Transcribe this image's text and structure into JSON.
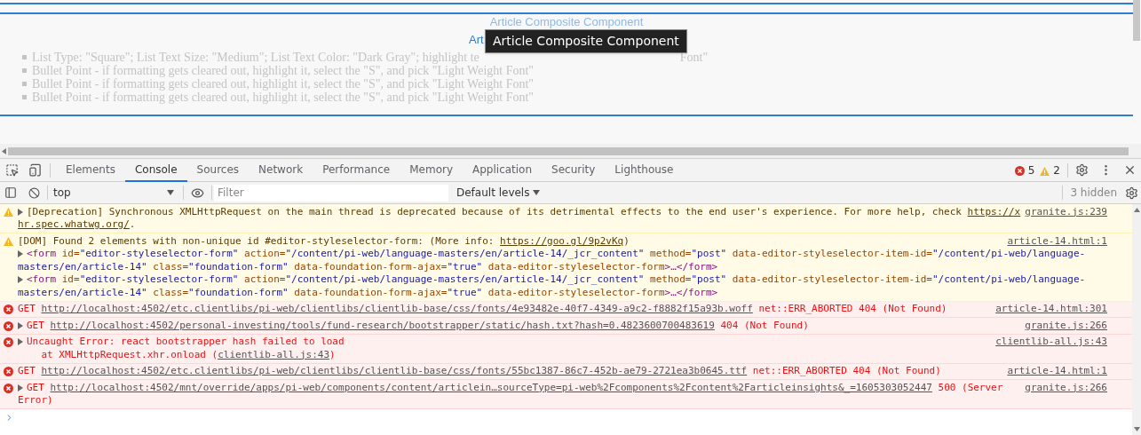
{
  "page": {
    "faded_title": "Article Composite Component",
    "title_visible": "Art",
    "tooltip": "Article Composite Component",
    "list_items": [
      {
        "segments": [
          "List Type: \"Square\"; List Text Size: \"Medium\"; List Text Color: \"Dark Gray\"; highlight te",
          "Font\""
        ]
      },
      {
        "segments": [
          "Bullet Point - if formatting gets cleared out, highlight it, select the \"S\", and pick \"Light Weight Font\""
        ]
      },
      {
        "segments": [
          "Bullet Point - if formatting gets cleared out, highlight it, select the \"S\", and pick \"Light Weight Font\""
        ]
      },
      {
        "segments": [
          "Bullet Point - if formatting gets cleared out, highlight it, select the \"S\", and pick \"Light Weight Font\""
        ]
      }
    ]
  },
  "devtools": {
    "tabs": [
      {
        "label": "Elements",
        "selected": false
      },
      {
        "label": "Console",
        "selected": true
      },
      {
        "label": "Sources",
        "selected": false
      },
      {
        "label": "Network",
        "selected": false
      },
      {
        "label": "Performance",
        "selected": false
      },
      {
        "label": "Memory",
        "selected": false
      },
      {
        "label": "Application",
        "selected": false
      },
      {
        "label": "Security",
        "selected": false
      },
      {
        "label": "Lighthouse",
        "selected": false
      }
    ],
    "error_count": "5",
    "warning_count": "2",
    "context": "top",
    "filter": {
      "placeholder": "Filter"
    },
    "levels": "Default levels",
    "hidden": "3 hidden"
  },
  "console": {
    "messages": [
      {
        "kind": "warning",
        "source": "granite.js:239",
        "lines": [
          {
            "expandable": true,
            "segments": [
              {
                "kind": "text",
                "text": "[Deprecation] Synchronous XMLHttpRequest on the main thread is deprecated because of its detrimental effects to the end user's experience. For more help, check "
              },
              {
                "kind": "link",
                "text": "https://x"
              }
            ]
          },
          {
            "expandable": false,
            "segments": [
              {
                "kind": "link",
                "text": "hr.spec.whatwg.org/"
              },
              {
                "kind": "text",
                "text": "."
              }
            ]
          }
        ]
      },
      {
        "kind": "warning",
        "source": "article-14.html:1",
        "lines": [
          {
            "expandable": false,
            "segments": [
              {
                "kind": "text",
                "text": "[DOM] Found 2 elements with non-unique id #editor-styleselector-form: (More info: "
              },
              {
                "kind": "link",
                "text": "https://goo.gl/9p2vKq"
              },
              {
                "kind": "text",
                "text": ")"
              }
            ]
          },
          {
            "expandable": true,
            "segments": [
              {
                "kind": "tag",
                "text": "<form"
              },
              {
                "kind": "attr",
                "text": " id="
              },
              {
                "kind": "value",
                "text": "\"editor-styleselector-form\""
              },
              {
                "kind": "attr",
                "text": " action="
              },
              {
                "kind": "value",
                "text": "\"/content/pi-web/language-masters/en/article-14/_jcr_content\""
              },
              {
                "kind": "attr",
                "text": " method="
              },
              {
                "kind": "value",
                "text": "\"post\""
              },
              {
                "kind": "attr",
                "text": " data-editor-styleselector-item-id="
              },
              {
                "kind": "value",
                "text": "\"/content/pi-web/language-"
              }
            ]
          },
          {
            "expandable": false,
            "segments": [
              {
                "kind": "value",
                "text": "masters/en/article-14\""
              },
              {
                "kind": "attr",
                "text": " class="
              },
              {
                "kind": "value",
                "text": "\"foundation-form\""
              },
              {
                "kind": "attr",
                "text": " data-foundation-form-ajax="
              },
              {
                "kind": "value",
                "text": "\"true\""
              },
              {
                "kind": "attr",
                "text": " data-editor-styleselector-form"
              },
              {
                "kind": "tag",
                "text": ">…</form>"
              }
            ]
          },
          {
            "expandable": true,
            "segments": [
              {
                "kind": "tag",
                "text": "<form"
              },
              {
                "kind": "attr",
                "text": " id="
              },
              {
                "kind": "value",
                "text": "\"editor-styleselector-form\""
              },
              {
                "kind": "attr",
                "text": " action="
              },
              {
                "kind": "value",
                "text": "\"/content/pi-web/language-masters/en/article-14/_jcr_content\""
              },
              {
                "kind": "attr",
                "text": " method="
              },
              {
                "kind": "value",
                "text": "\"post\""
              },
              {
                "kind": "attr",
                "text": " data-editor-styleselector-item-id="
              },
              {
                "kind": "value",
                "text": "\"/content/pi-web/language-"
              }
            ]
          },
          {
            "expandable": false,
            "segments": [
              {
                "kind": "value",
                "text": "masters/en/article-14\""
              },
              {
                "kind": "attr",
                "text": " class="
              },
              {
                "kind": "value",
                "text": "\"foundation-form\""
              },
              {
                "kind": "attr",
                "text": " data-foundation-form-ajax="
              },
              {
                "kind": "value",
                "text": "\"true\""
              },
              {
                "kind": "attr",
                "text": " data-editor-styleselector-form"
              },
              {
                "kind": "tag",
                "text": ">…</form>"
              }
            ]
          }
        ]
      },
      {
        "kind": "error",
        "source": "article-14.html:301",
        "lines": [
          {
            "expandable": false,
            "segments": [
              {
                "kind": "text",
                "text": "GET "
              },
              {
                "kind": "link",
                "text": "http://localhost:4502/etc.clientlibs/pi-web/clientlibs/clientlib-base/css/fonts/4e93482e-40f7-4349-a9c2-f8882f15a93b.woff"
              },
              {
                "kind": "text",
                "text": " net::ERR_ABORTED 404 (Not Found)"
              }
            ]
          }
        ]
      },
      {
        "kind": "error",
        "source": "granite.js:266",
        "lines": [
          {
            "expandable": true,
            "segments": [
              {
                "kind": "text",
                "text": "GET "
              },
              {
                "kind": "link",
                "text": "http://localhost:4502/personal-investing/tools/fund-research/bootstrapper/static/hash.txt?hash=0.4823600700483619"
              },
              {
                "kind": "text",
                "text": " 404 (Not Found)"
              }
            ]
          }
        ]
      },
      {
        "kind": "error",
        "source": "clientlib-all.js:43",
        "lines": [
          {
            "expandable": true,
            "segments": [
              {
                "kind": "text",
                "text": "Uncaught Error: react bootstrapper hash failed to load"
              }
            ]
          },
          {
            "expandable": false,
            "segments": [
              {
                "kind": "text",
                "text": "    at XMLHttpRequest.xhr.onload ("
              },
              {
                "kind": "link",
                "text": "clientlib-all.js:43"
              },
              {
                "kind": "text",
                "text": ")"
              }
            ]
          }
        ]
      },
      {
        "kind": "error",
        "source": "article-14.html:1",
        "lines": [
          {
            "expandable": false,
            "segments": [
              {
                "kind": "text",
                "text": "GET "
              },
              {
                "kind": "link",
                "text": "http://localhost:4502/etc.clientlibs/pi-web/clientlibs/clientlib-base/css/fonts/55bc1387-86c7-452b-ae79-2721ea3b0645.ttf"
              },
              {
                "kind": "text",
                "text": " net::ERR_ABORTED 404 (Not Found)"
              }
            ]
          }
        ]
      },
      {
        "kind": "error",
        "source": "granite.js:266",
        "lines": [
          {
            "expandable": true,
            "segments": [
              {
                "kind": "text",
                "text": "GET "
              },
              {
                "kind": "link",
                "text": "http://localhost:4502/mnt/override/apps/pi-web/components/content/articlein…sourceType=pi-web%2Fcomponents%2Fcontent%2Farticleinsights&_=1605303052447"
              },
              {
                "kind": "text",
                "text": " 500 (Server"
              }
            ]
          },
          {
            "expandable": false,
            "segments": [
              {
                "kind": "text",
                "text": "Error)"
              }
            ]
          }
        ]
      }
    ]
  }
}
